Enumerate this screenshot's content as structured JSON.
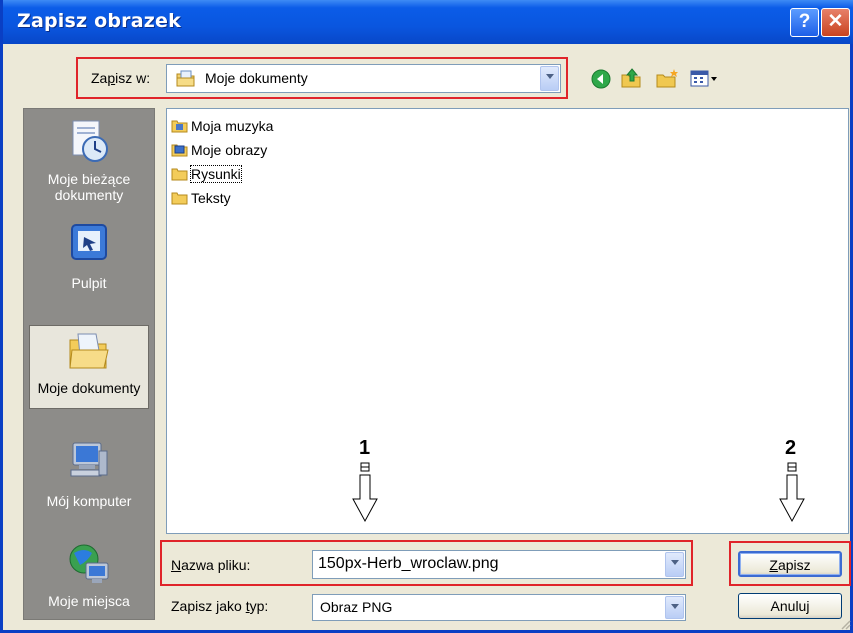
{
  "window": {
    "title": "Zapisz obrazek"
  },
  "lookin": {
    "label_pre": "Za",
    "label_u": "p",
    "label_post": "isz w:",
    "value": "Moje dokumenty"
  },
  "places": [
    {
      "line1": "Moje bieżące",
      "line2": "dokumenty"
    },
    {
      "line1": "Pulpit",
      "line2": ""
    },
    {
      "line1": "Moje dokumenty",
      "line2": ""
    },
    {
      "line1": "Mój komputer",
      "line2": ""
    },
    {
      "line1": "Moje miejsca",
      "line2": ""
    }
  ],
  "files": [
    "Moja muzyka",
    "Moje obrazy",
    "Rysunki",
    "Teksty"
  ],
  "filename": {
    "label_u": "N",
    "label_post": "azwa pliku:",
    "value": "150px-Herb_wroclaw.png"
  },
  "filetype": {
    "label_pre": "Zapisz jako ",
    "label_u": "t",
    "label_post": "yp:",
    "value": "Obraz PNG"
  },
  "buttons": {
    "save_u": "Z",
    "save_post": "apisz",
    "cancel": "Anuluj"
  },
  "annotations": {
    "first": "1",
    "second": "2"
  },
  "colors": {
    "titlebar": "#0a56df",
    "highlight": "#e0242a",
    "face": "#ece9d8"
  }
}
